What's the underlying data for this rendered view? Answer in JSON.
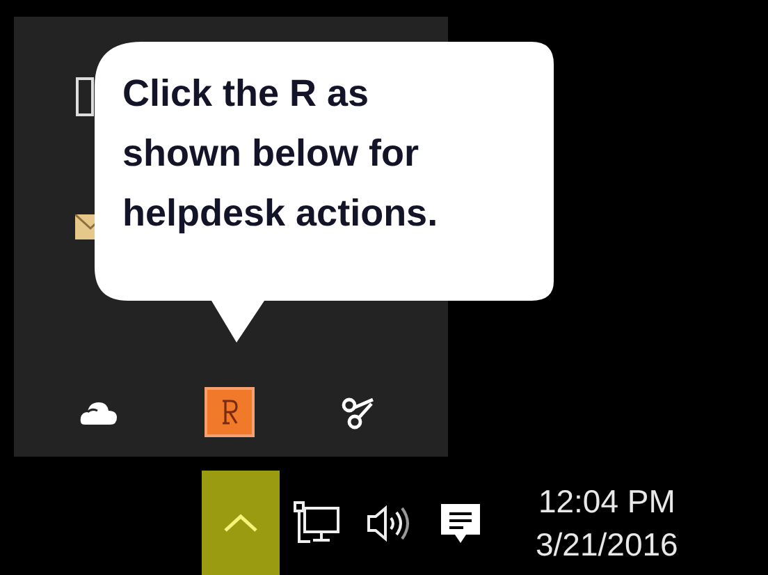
{
  "tray_overflow": {
    "callout": "Click the R as\nshown below for\nhelpdesk actions."
  },
  "taskbar": {
    "overflow_button": {
      "selected": true
    },
    "clock": {
      "time": "12:04 PM",
      "date": "3/21/2016"
    }
  }
}
